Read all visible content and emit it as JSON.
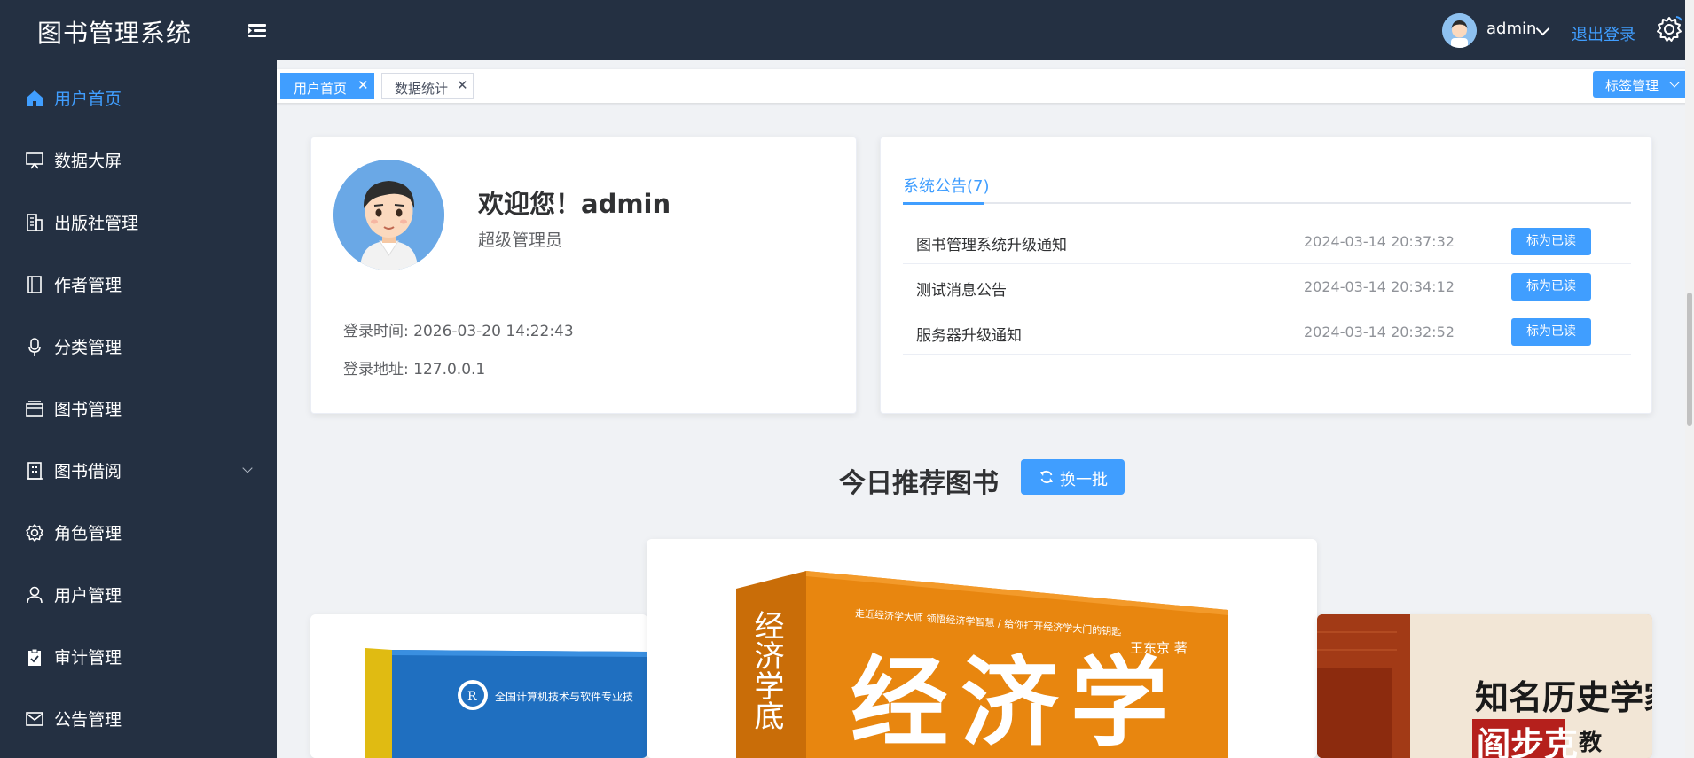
{
  "app": {
    "title": "图书管理系统"
  },
  "header": {
    "user_name": "admin",
    "logout_label": "退出登录"
  },
  "sidebar": {
    "items": [
      {
        "label": "用户首页",
        "icon": "home-icon",
        "active": true
      },
      {
        "label": "数据大屏",
        "icon": "monitor-icon"
      },
      {
        "label": "出版社管理",
        "icon": "building-icon"
      },
      {
        "label": "作者管理",
        "icon": "notebook-icon"
      },
      {
        "label": "分类管理",
        "icon": "microphone-icon"
      },
      {
        "label": "图书管理",
        "icon": "wallet-icon"
      },
      {
        "label": "图书借阅",
        "icon": "office-building-icon",
        "expandable": true
      },
      {
        "label": "角色管理",
        "icon": "setting-icon"
      },
      {
        "label": "用户管理",
        "icon": "user-icon"
      },
      {
        "label": "审计管理",
        "icon": "checked-clipboard-icon"
      },
      {
        "label": "公告管理",
        "icon": "message-icon"
      }
    ]
  },
  "tags": {
    "items": [
      {
        "label": "用户首页",
        "active": true
      },
      {
        "label": "数据统计",
        "active": false
      }
    ],
    "manage_label": "标签管理"
  },
  "user_card": {
    "welcome": "欢迎您！admin",
    "role": "超级管理员",
    "login_time_label": "登录时间:",
    "login_time": "2026-03-20 14:22:43",
    "login_addr_label": "登录地址:",
    "login_addr": "127.0.0.1"
  },
  "notices": {
    "tab_label": "系统公告(7)",
    "items": [
      {
        "title": "图书管理系统升级通知",
        "time": "2024-03-14 20:37:32",
        "action": "标为已读"
      },
      {
        "title": "测试消息公告",
        "time": "2024-03-14 20:34:12",
        "action": "标为已读"
      },
      {
        "title": "服务器升级通知",
        "time": "2024-03-14 20:32:52",
        "action": "标为已读"
      }
    ]
  },
  "recommend": {
    "title": "今日推荐图书",
    "refresh_label": "换一批",
    "books": [
      {
        "cover_text": "全国计算机技术与软件专业技",
        "color": "#1f6fc0"
      },
      {
        "cover_title": "经济学",
        "cover_spine": "经济学底",
        "cover_tagline": "走近经济学大师 领悟经济学智慧 / 给你打开经济学大门的钥匙",
        "author": "王东京 著",
        "color": "#e8860f"
      },
      {
        "cover_text": "知名历史学家",
        "cover_name": "阎步克",
        "cover_suffix": "教",
        "color": "#c94a1a"
      }
    ]
  },
  "colors": {
    "accent": "#409eff",
    "sidebar_bg": "#243042",
    "header_bg": "#243042"
  }
}
